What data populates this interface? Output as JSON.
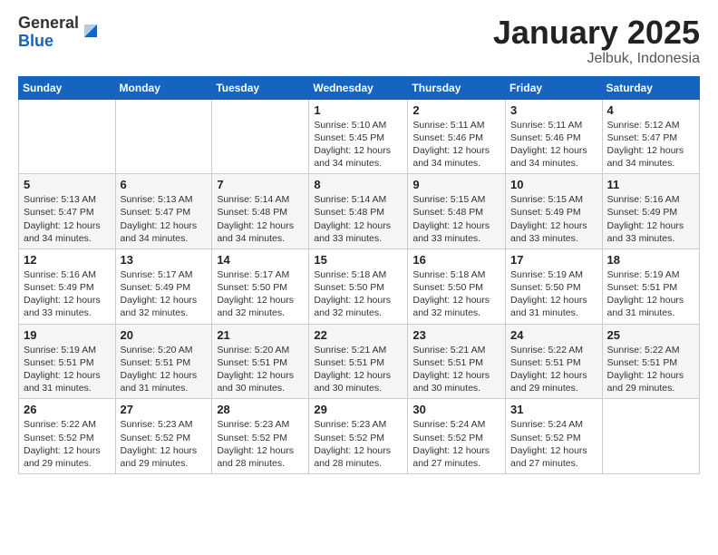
{
  "logo": {
    "general": "General",
    "blue": "Blue"
  },
  "header": {
    "month": "January 2025",
    "location": "Jelbuk, Indonesia"
  },
  "weekdays": [
    "Sunday",
    "Monday",
    "Tuesday",
    "Wednesday",
    "Thursday",
    "Friday",
    "Saturday"
  ],
  "weeks": [
    [
      {
        "day": "",
        "info": ""
      },
      {
        "day": "",
        "info": ""
      },
      {
        "day": "",
        "info": ""
      },
      {
        "day": "1",
        "info": "Sunrise: 5:10 AM\nSunset: 5:45 PM\nDaylight: 12 hours\nand 34 minutes."
      },
      {
        "day": "2",
        "info": "Sunrise: 5:11 AM\nSunset: 5:46 PM\nDaylight: 12 hours\nand 34 minutes."
      },
      {
        "day": "3",
        "info": "Sunrise: 5:11 AM\nSunset: 5:46 PM\nDaylight: 12 hours\nand 34 minutes."
      },
      {
        "day": "4",
        "info": "Sunrise: 5:12 AM\nSunset: 5:47 PM\nDaylight: 12 hours\nand 34 minutes."
      }
    ],
    [
      {
        "day": "5",
        "info": "Sunrise: 5:13 AM\nSunset: 5:47 PM\nDaylight: 12 hours\nand 34 minutes."
      },
      {
        "day": "6",
        "info": "Sunrise: 5:13 AM\nSunset: 5:47 PM\nDaylight: 12 hours\nand 34 minutes."
      },
      {
        "day": "7",
        "info": "Sunrise: 5:14 AM\nSunset: 5:48 PM\nDaylight: 12 hours\nand 34 minutes."
      },
      {
        "day": "8",
        "info": "Sunrise: 5:14 AM\nSunset: 5:48 PM\nDaylight: 12 hours\nand 33 minutes."
      },
      {
        "day": "9",
        "info": "Sunrise: 5:15 AM\nSunset: 5:48 PM\nDaylight: 12 hours\nand 33 minutes."
      },
      {
        "day": "10",
        "info": "Sunrise: 5:15 AM\nSunset: 5:49 PM\nDaylight: 12 hours\nand 33 minutes."
      },
      {
        "day": "11",
        "info": "Sunrise: 5:16 AM\nSunset: 5:49 PM\nDaylight: 12 hours\nand 33 minutes."
      }
    ],
    [
      {
        "day": "12",
        "info": "Sunrise: 5:16 AM\nSunset: 5:49 PM\nDaylight: 12 hours\nand 33 minutes."
      },
      {
        "day": "13",
        "info": "Sunrise: 5:17 AM\nSunset: 5:49 PM\nDaylight: 12 hours\nand 32 minutes."
      },
      {
        "day": "14",
        "info": "Sunrise: 5:17 AM\nSunset: 5:50 PM\nDaylight: 12 hours\nand 32 minutes."
      },
      {
        "day": "15",
        "info": "Sunrise: 5:18 AM\nSunset: 5:50 PM\nDaylight: 12 hours\nand 32 minutes."
      },
      {
        "day": "16",
        "info": "Sunrise: 5:18 AM\nSunset: 5:50 PM\nDaylight: 12 hours\nand 32 minutes."
      },
      {
        "day": "17",
        "info": "Sunrise: 5:19 AM\nSunset: 5:50 PM\nDaylight: 12 hours\nand 31 minutes."
      },
      {
        "day": "18",
        "info": "Sunrise: 5:19 AM\nSunset: 5:51 PM\nDaylight: 12 hours\nand 31 minutes."
      }
    ],
    [
      {
        "day": "19",
        "info": "Sunrise: 5:19 AM\nSunset: 5:51 PM\nDaylight: 12 hours\nand 31 minutes."
      },
      {
        "day": "20",
        "info": "Sunrise: 5:20 AM\nSunset: 5:51 PM\nDaylight: 12 hours\nand 31 minutes."
      },
      {
        "day": "21",
        "info": "Sunrise: 5:20 AM\nSunset: 5:51 PM\nDaylight: 12 hours\nand 30 minutes."
      },
      {
        "day": "22",
        "info": "Sunrise: 5:21 AM\nSunset: 5:51 PM\nDaylight: 12 hours\nand 30 minutes."
      },
      {
        "day": "23",
        "info": "Sunrise: 5:21 AM\nSunset: 5:51 PM\nDaylight: 12 hours\nand 30 minutes."
      },
      {
        "day": "24",
        "info": "Sunrise: 5:22 AM\nSunset: 5:51 PM\nDaylight: 12 hours\nand 29 minutes."
      },
      {
        "day": "25",
        "info": "Sunrise: 5:22 AM\nSunset: 5:51 PM\nDaylight: 12 hours\nand 29 minutes."
      }
    ],
    [
      {
        "day": "26",
        "info": "Sunrise: 5:22 AM\nSunset: 5:52 PM\nDaylight: 12 hours\nand 29 minutes."
      },
      {
        "day": "27",
        "info": "Sunrise: 5:23 AM\nSunset: 5:52 PM\nDaylight: 12 hours\nand 29 minutes."
      },
      {
        "day": "28",
        "info": "Sunrise: 5:23 AM\nSunset: 5:52 PM\nDaylight: 12 hours\nand 28 minutes."
      },
      {
        "day": "29",
        "info": "Sunrise: 5:23 AM\nSunset: 5:52 PM\nDaylight: 12 hours\nand 28 minutes."
      },
      {
        "day": "30",
        "info": "Sunrise: 5:24 AM\nSunset: 5:52 PM\nDaylight: 12 hours\nand 27 minutes."
      },
      {
        "day": "31",
        "info": "Sunrise: 5:24 AM\nSunset: 5:52 PM\nDaylight: 12 hours\nand 27 minutes."
      },
      {
        "day": "",
        "info": ""
      }
    ]
  ]
}
